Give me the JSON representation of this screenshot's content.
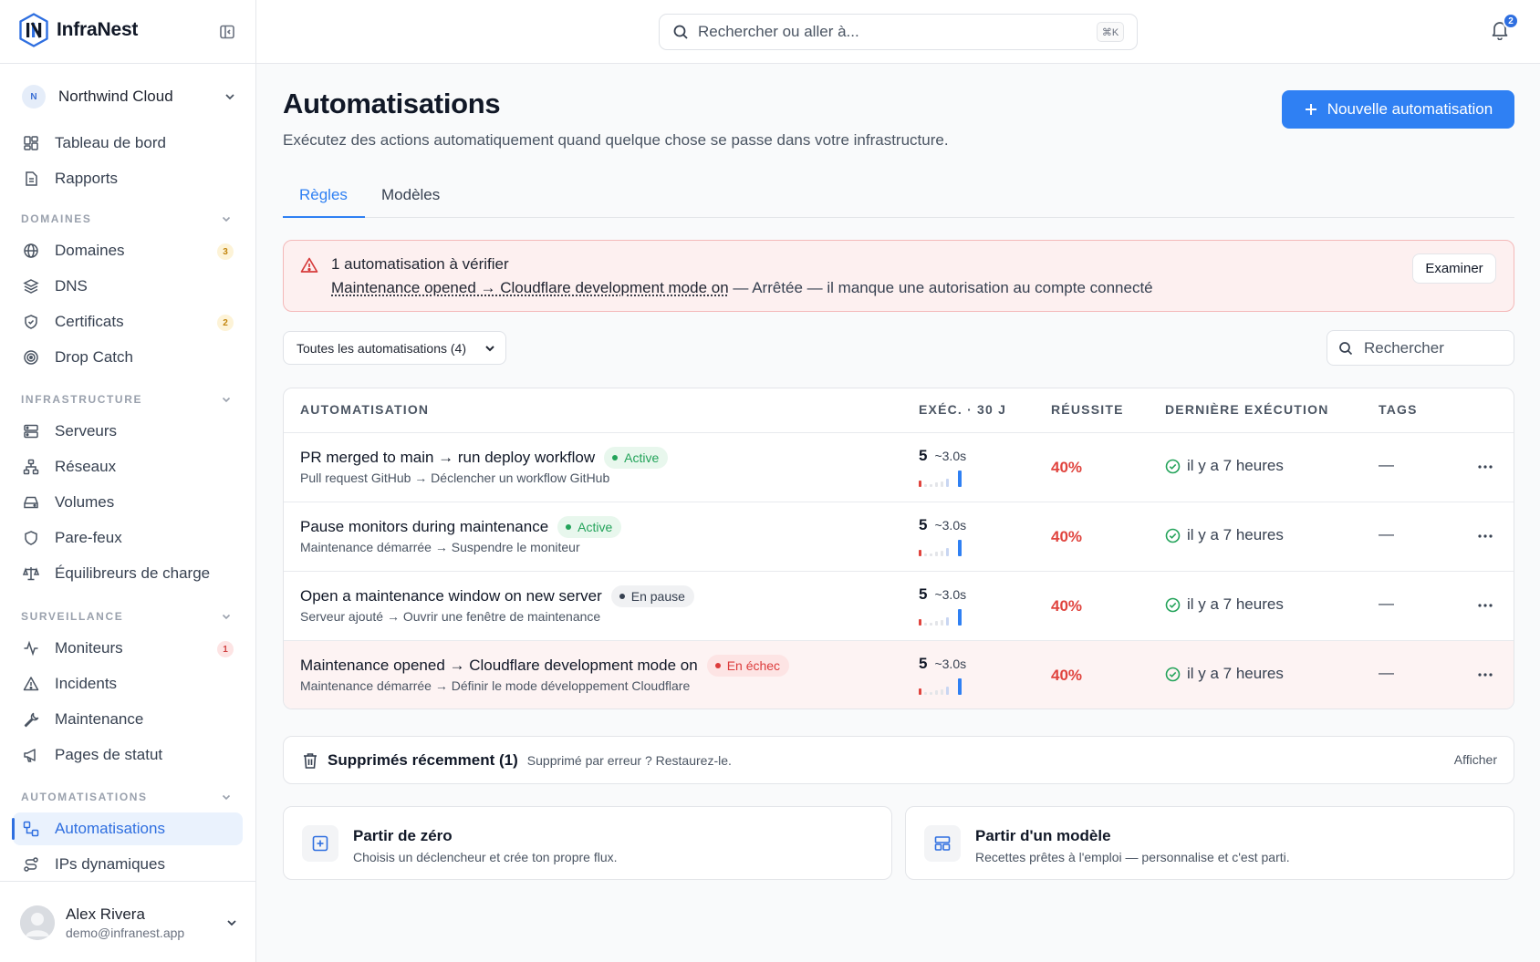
{
  "app": {
    "name": "InfraNest"
  },
  "org": {
    "initial": "N",
    "name": "Northwind Cloud"
  },
  "nav": {
    "top": [
      {
        "label": "Tableau de bord",
        "icon": "dashboard-icon"
      },
      {
        "label": "Rapports",
        "icon": "report-icon"
      }
    ],
    "sections": {
      "domaines": "DOMAINES",
      "infrastructure": "INFRASTRUCTURE",
      "surveillance": "SURVEILLANCE",
      "automatisations": "AUTOMATISATIONS"
    },
    "domaines": [
      {
        "label": "Domaines",
        "badge": "3"
      },
      {
        "label": "DNS"
      },
      {
        "label": "Certificats",
        "badge": "2"
      },
      {
        "label": "Drop Catch"
      }
    ],
    "infrastructure": [
      {
        "label": "Serveurs"
      },
      {
        "label": "Réseaux"
      },
      {
        "label": "Volumes"
      },
      {
        "label": "Pare-feux"
      },
      {
        "label": "Équilibreurs de charge"
      }
    ],
    "surveillance": [
      {
        "label": "Moniteurs",
        "badge": "1"
      },
      {
        "label": "Incidents"
      },
      {
        "label": "Maintenance"
      },
      {
        "label": "Pages de statut"
      }
    ],
    "automatisations": [
      {
        "label": "Automatisations",
        "active": true
      },
      {
        "label": "IPs dynamiques"
      }
    ]
  },
  "user": {
    "name": "Alex Rivera",
    "email": "demo@infranest.app"
  },
  "topbar": {
    "search_placeholder": "Rechercher ou aller à...",
    "shortcut": "⌘K",
    "notifications": "2"
  },
  "page": {
    "title": "Automatisations",
    "subtitle": "Exécutez des actions automatiquement quand quelque chose se passe dans votre infrastructure.",
    "new_button": "Nouvelle automatisation",
    "tabs": [
      "Règles",
      "Modèles"
    ]
  },
  "alert": {
    "title": "1 automatisation à vérifier",
    "link": "Maintenance opened → Cloudflare development mode on",
    "message": " — Arrêtée — il manque une autorisation au compte connecté",
    "button": "Examiner"
  },
  "filter": {
    "selected": "Toutes les automatisations (4)",
    "search_placeholder": "Rechercher"
  },
  "table": {
    "columns": [
      "AUTOMATISATION",
      "EXÉC. · 30 J",
      "RÉUSSITE",
      "DERNIÈRE EXÉCUTION",
      "TAGS"
    ],
    "rows": [
      {
        "name": "PR merged to main → run deploy workflow",
        "status": "Active",
        "status_kind": "active",
        "desc": "Pull request GitHub → Déclencher un workflow GitHub",
        "runs": "5",
        "avg": "~3.0s",
        "success": "40%",
        "last": "il y a 7 heures",
        "tags": "—"
      },
      {
        "name": "Pause monitors during maintenance",
        "status": "Active",
        "status_kind": "active",
        "desc": "Maintenance démarrée → Suspendre le moniteur",
        "runs": "5",
        "avg": "~3.0s",
        "success": "40%",
        "last": "il y a 7 heures",
        "tags": "—"
      },
      {
        "name": "Open a maintenance window on new server",
        "status": "En pause",
        "status_kind": "paused",
        "desc": "Serveur ajouté → Ouvrir une fenêtre de maintenance",
        "runs": "5",
        "avg": "~3.0s",
        "success": "40%",
        "last": "il y a 7 heures",
        "tags": "—"
      },
      {
        "name": "Maintenance opened → Cloudflare development mode on",
        "status": "En échec",
        "status_kind": "failed",
        "desc": "Maintenance démarrée → Définir le mode développement Cloudflare",
        "runs": "5",
        "avg": "~3.0s",
        "success": "40%",
        "last": "il y a 7 heures",
        "tags": "—"
      }
    ]
  },
  "deleted": {
    "title": "Supprimés récemment (1)",
    "subtitle": "Supprimé par erreur ? Restaurez-le.",
    "action": "Afficher"
  },
  "cards": [
    {
      "title": "Partir de zéro",
      "subtitle": "Choisis un déclencheur et crée ton propre flux.",
      "icon": "plus-square-icon"
    },
    {
      "title": "Partir d'un modèle",
      "subtitle": "Recettes prêtes à l'emploi — personnalise et c'est parti.",
      "icon": "template-icon"
    }
  ],
  "colors": {
    "accent": "#2f80f3",
    "success": "#23a35a",
    "danger": "#dc3b3b",
    "warning": "#c2840c"
  }
}
